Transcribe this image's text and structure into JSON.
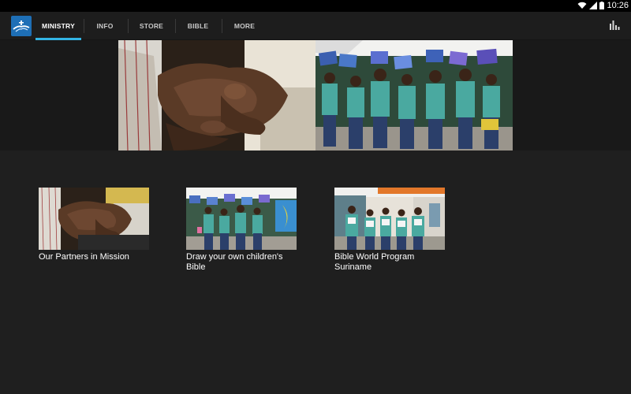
{
  "status_bar": {
    "time": "10:26",
    "icons": [
      "wifi-icon",
      "signal-icon",
      "battery-icon"
    ]
  },
  "action_bar": {
    "logo_icon": "bible-society-logo-icon",
    "tabs": [
      {
        "label": "MINISTRY",
        "active": true
      },
      {
        "label": "INFO",
        "active": false
      },
      {
        "label": "STORE",
        "active": false
      },
      {
        "label": "BIBLE",
        "active": false
      },
      {
        "label": "MORE",
        "active": false
      }
    ],
    "stats_icon": "bar-chart-icon"
  },
  "colors": {
    "accent": "#33b5e5",
    "background": "#1f1f1f",
    "action_bar": "#1d1d1d",
    "status_bar": "#000000"
  },
  "hero": {
    "images": [
      "handshake-photo",
      "children-holding-drawings-photo"
    ]
  },
  "cards": [
    {
      "title": "Our Partners in Mission",
      "image": "handshake-photo"
    },
    {
      "title": "Draw your own children's Bible",
      "image": "children-with-drawings-photo"
    },
    {
      "title": "Bible World Program Suriname",
      "image": "children-reading-photo"
    }
  ]
}
